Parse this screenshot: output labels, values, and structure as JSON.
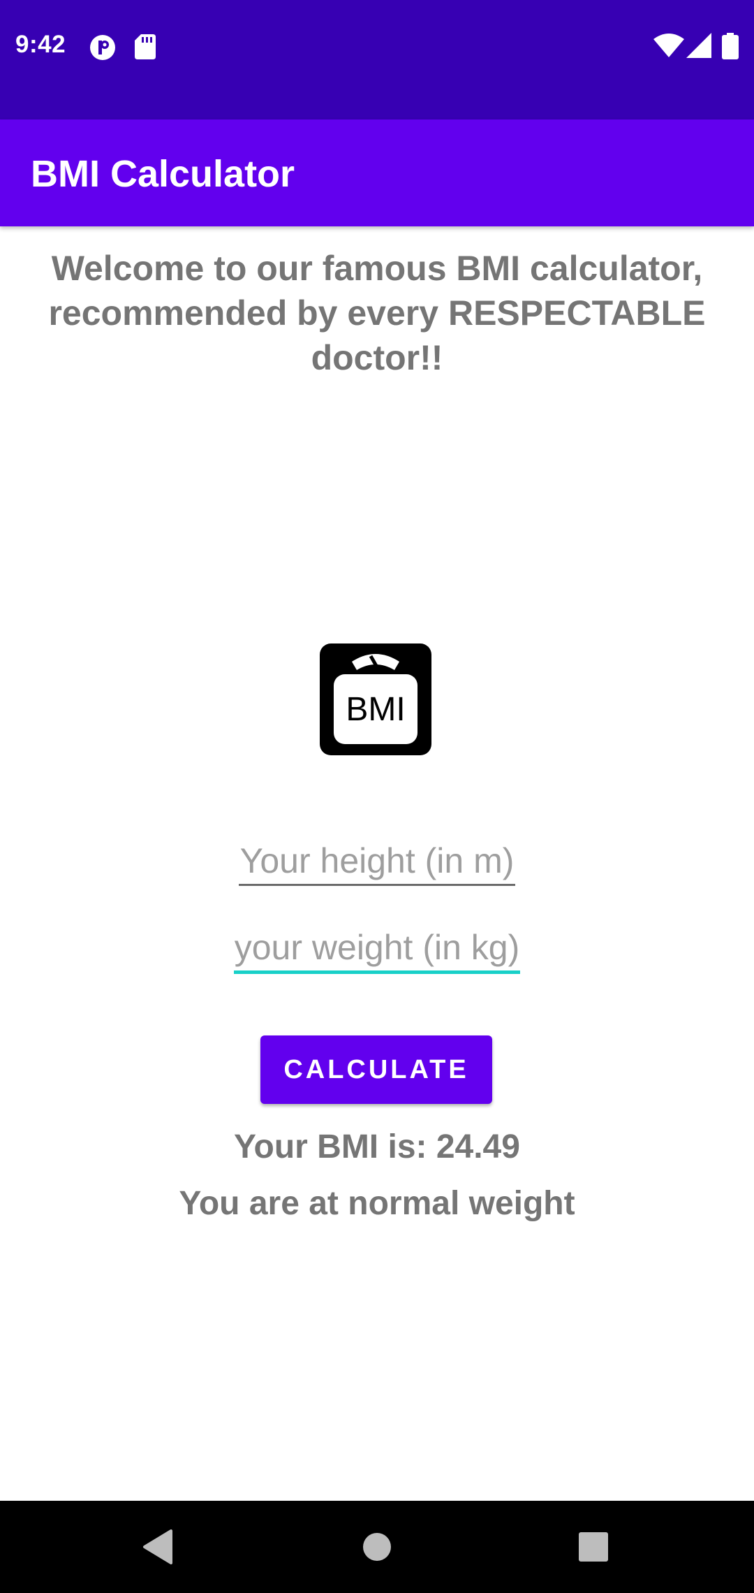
{
  "status_bar": {
    "time": "9:42",
    "left_icons": [
      "notification-p-icon",
      "sd-card-icon"
    ],
    "right_icons": [
      "wifi-icon",
      "signal-icon",
      "battery-icon"
    ],
    "background": "#3700b3"
  },
  "app_bar": {
    "title": "BMI Calculator",
    "background": "#6200ee"
  },
  "main": {
    "welcome_text": "Welcome to our famous BMI calculator, recommended by every RESPECTABLE doctor!!",
    "logo_text": "BMI",
    "height_input": {
      "placeholder": "Your height (in m)",
      "value": ""
    },
    "weight_input": {
      "placeholder": "your weight (in kg)",
      "value": ""
    },
    "calculate_label": "CALCULATE",
    "bmi_result": "Your BMI is: 24.49",
    "bmi_category": "You are at normal weight"
  },
  "nav_bar": {
    "items": [
      "back-icon",
      "home-icon",
      "recents-icon"
    ]
  },
  "colors": {
    "accent": "#6200ee",
    "focus_underline": "#18d0c8",
    "text_secondary": "#757575"
  }
}
